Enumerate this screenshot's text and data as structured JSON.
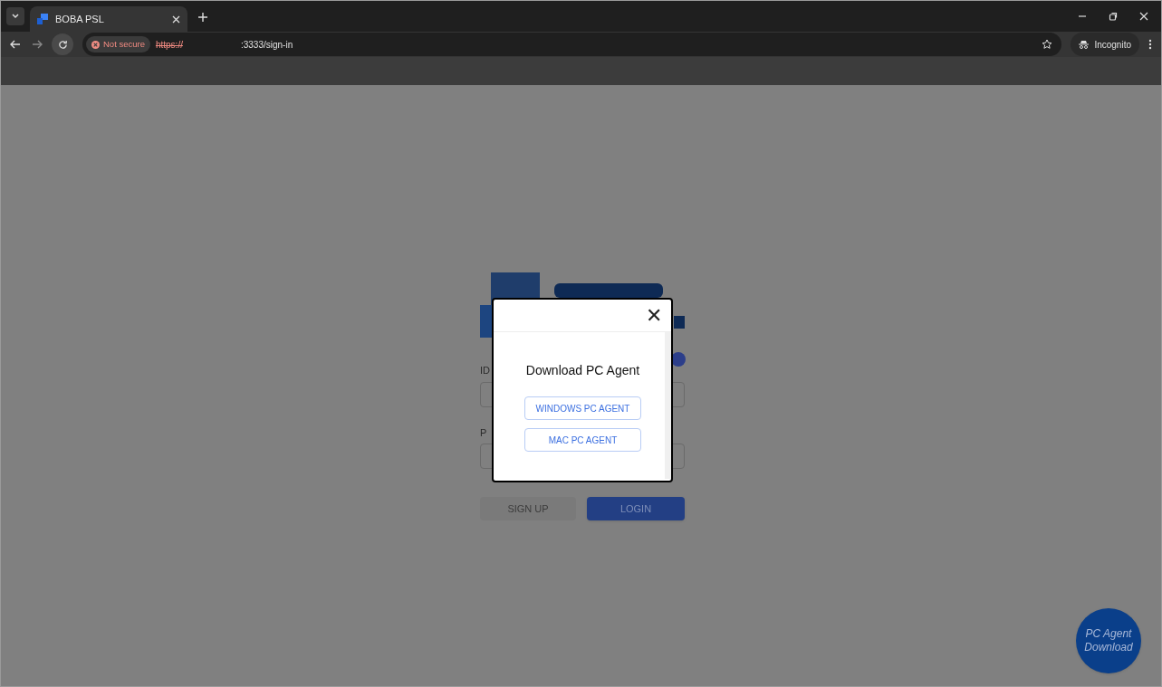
{
  "browser": {
    "tab": {
      "title": "BOBA PSL"
    },
    "security": "Not secure",
    "url_scheme": "https://",
    "url_rest": ":3333/sign-in",
    "profile": "Incognito"
  },
  "login": {
    "id_label": "ID",
    "pw_label": "P",
    "signup": "SIGN UP",
    "login": "LOGIN"
  },
  "modal": {
    "close": "✕",
    "title": "Download PC Agent",
    "buttons": [
      "WINDOWS PC AGENT",
      "MAC PC AGENT"
    ]
  },
  "fab": {
    "lines": [
      "PC Agent",
      "Download"
    ]
  }
}
